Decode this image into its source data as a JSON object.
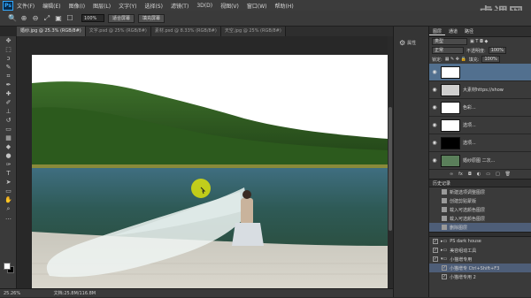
{
  "app": {
    "logo": "Ps"
  },
  "menu": [
    "文件(F)",
    "编辑(E)",
    "图像(I)",
    "图层(L)",
    "文字(Y)",
    "选择(S)",
    "滤镜(T)",
    "3D(D)",
    "视图(V)",
    "窗口(W)",
    "帮助(H)"
  ],
  "watermark": "虎课网",
  "options": {
    "zoom_value": "100%",
    "fit_screen": "适合屏幕",
    "fill_screen": "填充屏幕"
  },
  "tabs": [
    {
      "label": "婚纱.jpg @ 25.3% (RGB/8#)",
      "active": true
    },
    {
      "label": "文字.psd @ 25% (RGB/8#)",
      "active": false
    },
    {
      "label": "素材.psd @ 8.33% (RGB/8#)",
      "active": false
    },
    {
      "label": "天空.jpg @ 25% (RGB/8#)",
      "active": false
    }
  ],
  "status": {
    "zoom": "25.26%",
    "doc": "文档:25.8M/116.8M"
  },
  "mini_panel": {
    "label": "属性"
  },
  "layers_panel": {
    "tabs": [
      "图层",
      "通道",
      "路径"
    ],
    "kind_label": "类型",
    "blend_mode": "正常",
    "opacity_label": "不透明度:",
    "opacity_value": "100%",
    "lock_label": "锁定:",
    "fill_label": "填充:",
    "fill_value": "100%",
    "layers": [
      {
        "name": "",
        "thumb": "#ffffff",
        "active": true
      },
      {
        "name": "大素材https://show...",
        "thumb": "#cfcfcf",
        "active": false
      },
      {
        "name": "色彩...",
        "thumb": "#ffffff",
        "active": false
      },
      {
        "name": "选项...",
        "thumb": "#ffffff",
        "active": false
      },
      {
        "name": "选项...",
        "thumb": "#000000",
        "active": false
      },
      {
        "name": "婚纱原图 二次...",
        "thumb": "#5a7f5a",
        "active": false
      }
    ]
  },
  "history_panel": {
    "title": "历史记录",
    "items": [
      {
        "label": "新建选项调整图层",
        "active": false
      },
      {
        "label": "创建剪贴蒙版",
        "active": false
      },
      {
        "label": "载入可选颜色图层",
        "active": false
      },
      {
        "label": "载入可选颜色图层",
        "active": false
      },
      {
        "label": "删除图层",
        "active": true
      }
    ]
  },
  "actions_panel": {
    "items": [
      {
        "label": "PS dark house",
        "indent": 0,
        "active": false
      },
      {
        "label": "美容组动工具",
        "indent": 0,
        "active": false
      },
      {
        "label": "小猫增专用",
        "indent": 0,
        "active": false
      },
      {
        "label": "小猫增专 Ctrl+Shift+F3",
        "indent": 1,
        "active": true
      },
      {
        "label": "小猫增专用 2",
        "indent": 1,
        "active": false
      }
    ]
  },
  "colors": {
    "accent": "#52708f",
    "panel": "#3a3a3a"
  }
}
